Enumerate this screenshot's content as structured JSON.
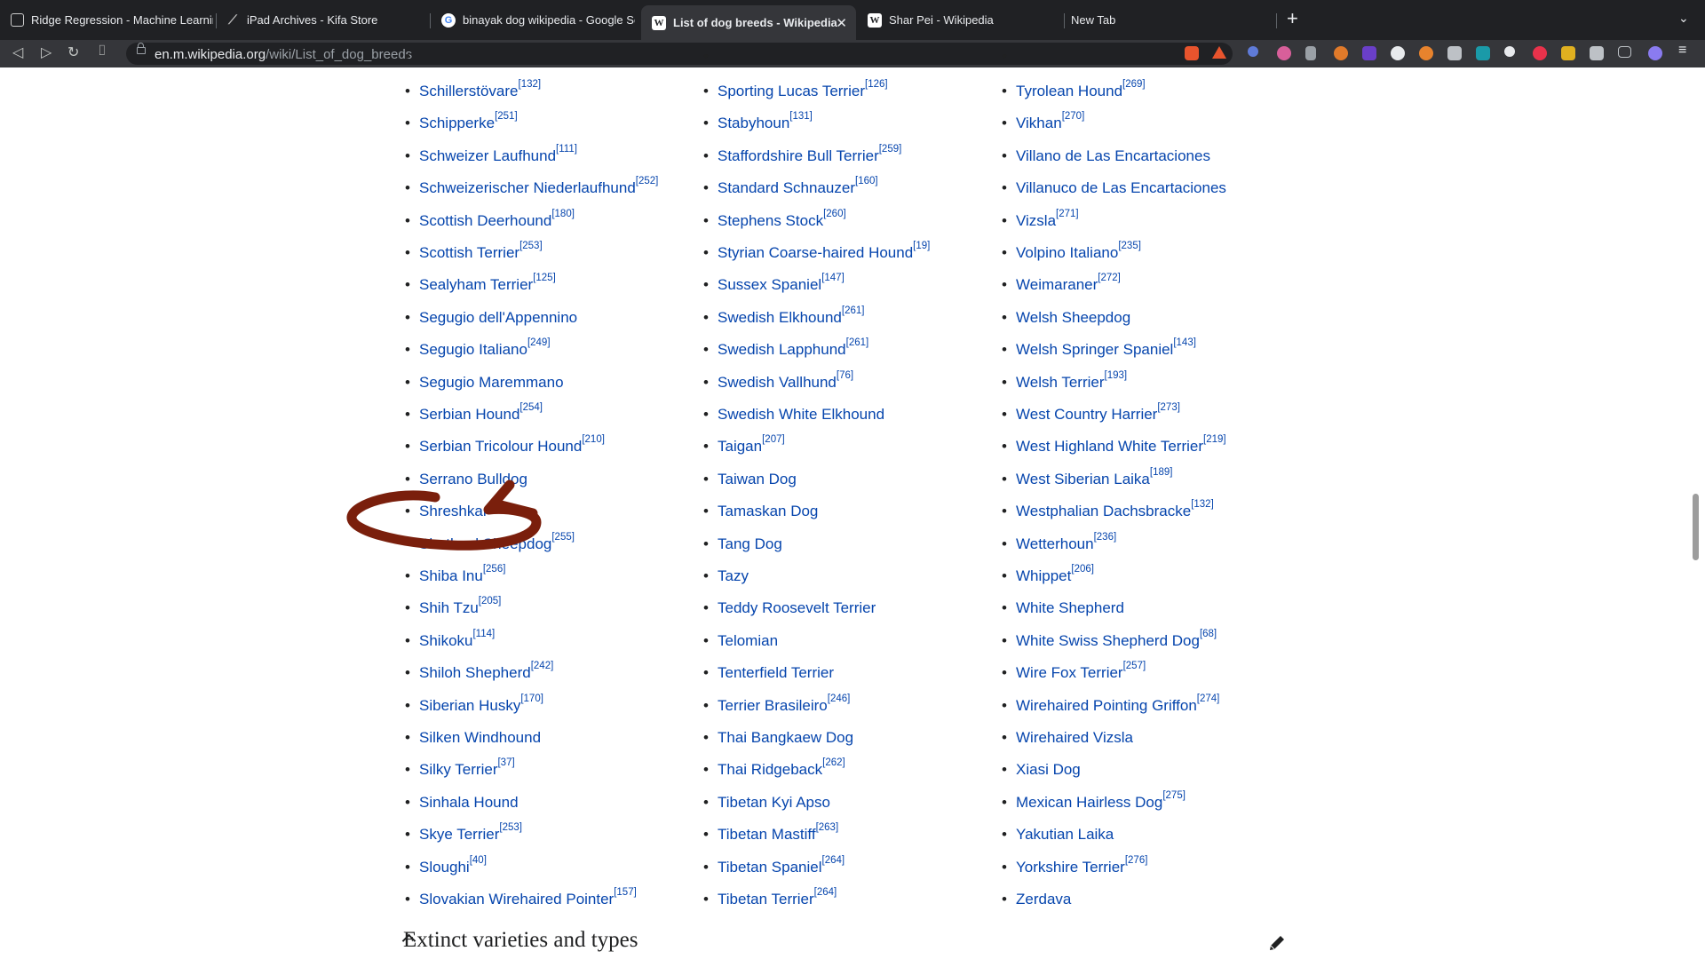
{
  "browser": {
    "tabs": [
      {
        "title": "Ridge Regression - Machine Learnin",
        "icon": "tab-window-icon"
      },
      {
        "title": "iPad Archives - Kifa Store",
        "icon": "kifa-icon"
      },
      {
        "title": "binayak dog wikipedia - Google Sea",
        "icon": "google-icon"
      },
      {
        "title": "List of dog breeds - Wikipedia",
        "icon": "wikipedia-icon",
        "active": true
      },
      {
        "title": "Shar Pei - Wikipedia",
        "icon": "wikipedia-icon"
      },
      {
        "title": "New Tab",
        "icon": ""
      }
    ],
    "url_domain": "en.m.wikipedia.org",
    "url_path": "/wiki/List_of_dog_breeds",
    "new_tab_symbol": "+",
    "close_symbol": "✕"
  },
  "columns": [
    [
      {
        "name": "Schillerstövare",
        "ref": "[132]"
      },
      {
        "name": "Schipperke",
        "ref": "[251]"
      },
      {
        "name": "Schweizer Laufhund",
        "ref": "[111]"
      },
      {
        "name": "Schweizerischer Niederlaufhund",
        "ref": "[252]"
      },
      {
        "name": "Scottish Deerhound",
        "ref": "[180]"
      },
      {
        "name": "Scottish Terrier",
        "ref": "[253]"
      },
      {
        "name": "Sealyham Terrier",
        "ref": "[125]"
      },
      {
        "name": "Segugio dell'Appennino",
        "ref": ""
      },
      {
        "name": "Segugio Italiano",
        "ref": "[249]"
      },
      {
        "name": "Segugio Maremmano",
        "ref": ""
      },
      {
        "name": "Serbian Hound",
        "ref": "[254]"
      },
      {
        "name": "Serbian Tricolour Hound",
        "ref": "[210]"
      },
      {
        "name": "Serrano Bulldog",
        "ref": ""
      },
      {
        "name": "Shreshkar",
        "ref": ""
      },
      {
        "name": "Shetland Sheepdog",
        "ref": "[255]"
      },
      {
        "name": "Shiba Inu",
        "ref": "[256]"
      },
      {
        "name": "Shih Tzu",
        "ref": "[205]"
      },
      {
        "name": "Shikoku",
        "ref": "[114]"
      },
      {
        "name": "Shiloh Shepherd",
        "ref": "[242]"
      },
      {
        "name": "Siberian Husky",
        "ref": "[170]"
      },
      {
        "name": "Silken Windhound",
        "ref": ""
      },
      {
        "name": "Silky Terrier",
        "ref": "[37]"
      },
      {
        "name": "Sinhala Hound",
        "ref": ""
      },
      {
        "name": "Skye Terrier",
        "ref": "[253]"
      },
      {
        "name": "Sloughi",
        "ref": "[40]"
      },
      {
        "name": "Slovakian Wirehaired Pointer",
        "ref": "[157]"
      }
    ],
    [
      {
        "name": "Sporting Lucas Terrier",
        "ref": "[126]"
      },
      {
        "name": "Stabyhoun",
        "ref": "[131]"
      },
      {
        "name": "Staffordshire Bull Terrier",
        "ref": "[259]"
      },
      {
        "name": "Standard Schnauzer",
        "ref": "[160]"
      },
      {
        "name": "Stephens Stock",
        "ref": "[260]"
      },
      {
        "name": "Styrian Coarse-haired Hound",
        "ref": "[19]"
      },
      {
        "name": "Sussex Spaniel",
        "ref": "[147]"
      },
      {
        "name": "Swedish Elkhound",
        "ref": "[261]"
      },
      {
        "name": "Swedish Lapphund",
        "ref": "[261]"
      },
      {
        "name": "Swedish Vallhund",
        "ref": "[76]"
      },
      {
        "name": "Swedish White Elkhound",
        "ref": ""
      },
      {
        "name": "Taigan",
        "ref": "[207]"
      },
      {
        "name": "Taiwan Dog",
        "ref": ""
      },
      {
        "name": "Tamaskan Dog",
        "ref": ""
      },
      {
        "name": "Tang Dog",
        "ref": ""
      },
      {
        "name": "Tazy",
        "ref": ""
      },
      {
        "name": "Teddy Roosevelt Terrier",
        "ref": ""
      },
      {
        "name": "Telomian",
        "ref": ""
      },
      {
        "name": "Tenterfield Terrier",
        "ref": ""
      },
      {
        "name": "Terrier Brasileiro",
        "ref": "[246]"
      },
      {
        "name": "Thai Bangkaew Dog",
        "ref": ""
      },
      {
        "name": "Thai Ridgeback",
        "ref": "[262]"
      },
      {
        "name": "Tibetan Kyi Apso",
        "ref": ""
      },
      {
        "name": "Tibetan Mastiff",
        "ref": "[263]"
      },
      {
        "name": "Tibetan Spaniel",
        "ref": "[264]"
      },
      {
        "name": "Tibetan Terrier",
        "ref": "[264]"
      }
    ],
    [
      {
        "name": "Tyrolean Hound",
        "ref": "[269]"
      },
      {
        "name": "Vikhan",
        "ref": "[270]"
      },
      {
        "name": "Villano de Las Encartaciones",
        "ref": ""
      },
      {
        "name": "Villanuco de Las Encartaciones",
        "ref": ""
      },
      {
        "name": "Vizsla",
        "ref": "[271]"
      },
      {
        "name": "Volpino Italiano",
        "ref": "[235]"
      },
      {
        "name": "Weimaraner",
        "ref": "[272]"
      },
      {
        "name": "Welsh Sheepdog",
        "ref": ""
      },
      {
        "name": "Welsh Springer Spaniel",
        "ref": "[143]"
      },
      {
        "name": "Welsh Terrier",
        "ref": "[193]"
      },
      {
        "name": "West Country Harrier",
        "ref": "[273]"
      },
      {
        "name": "West Highland White Terrier",
        "ref": "[219]"
      },
      {
        "name": "West Siberian Laika",
        "ref": "[189]"
      },
      {
        "name": "Westphalian Dachsbracke",
        "ref": "[132]"
      },
      {
        "name": "Wetterhoun",
        "ref": "[236]"
      },
      {
        "name": "Whippet",
        "ref": "[206]"
      },
      {
        "name": "White Shepherd",
        "ref": ""
      },
      {
        "name": "White Swiss Shepherd Dog",
        "ref": "[68]"
      },
      {
        "name": "Wire Fox Terrier",
        "ref": "[257]"
      },
      {
        "name": "Wirehaired Pointing Griffon",
        "ref": "[274]"
      },
      {
        "name": "Wirehaired Vizsla",
        "ref": ""
      },
      {
        "name": "Xiasi Dog",
        "ref": ""
      },
      {
        "name": "Mexican Hairless Dog",
        "ref": "[275]"
      },
      {
        "name": "Yakutian Laika",
        "ref": ""
      },
      {
        "name": "Yorkshire Terrier",
        "ref": "[276]"
      },
      {
        "name": "Zerdava",
        "ref": ""
      }
    ]
  ],
  "bullet": "•",
  "section": {
    "title": "Extinct varieties and types"
  },
  "annotation": {
    "color": "#7a1f0c",
    "circled_item": "Shreshkar"
  },
  "colors": {
    "link": "#0645ad",
    "text": "#202122",
    "chrome_dark": "#202124",
    "chrome_toolbar": "#35363a"
  }
}
